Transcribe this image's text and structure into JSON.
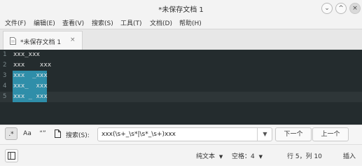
{
  "window": {
    "title": "*未保存文档 1",
    "minimize_glyph": "⌄",
    "maximize_glyph": "^",
    "close_glyph": "×"
  },
  "menu": {
    "file": "文件(F)",
    "edit": "编辑(E)",
    "view": "查看(V)",
    "search": "搜索(S)",
    "tools": "工具(T)",
    "documents": "文档(D)",
    "help": "帮助(H)"
  },
  "tab": {
    "label": "*未保存文档 1",
    "close_glyph": "×"
  },
  "editor": {
    "lines": [
      {
        "number": "1",
        "text": "xxx_xxx"
      },
      {
        "number": "2",
        "text": "xxx    xxx"
      },
      {
        "number": "3",
        "text": "xxx  _xxx"
      },
      {
        "number": "4",
        "text": "xxx_  xxx"
      },
      {
        "number": "5",
        "text": "xxx _ xxx"
      }
    ],
    "selected_lines": [
      "3",
      "4",
      "5"
    ],
    "current_line": "5"
  },
  "find": {
    "regex_option": ".*",
    "case_option": "Aa",
    "whole_word_option": "“”",
    "wrap_icon": "wrap-around-icon",
    "label": "搜索(S):",
    "value": "xxx(\\s+_\\s*|\\s*_\\s+)xxx",
    "next": "下一个",
    "previous": "上一个"
  },
  "status": {
    "syntax": "纯文本",
    "tab_width": "空格：4",
    "dropdown_glyph": "▼",
    "position": "行 5，列 10",
    "mode": "插入"
  },
  "colors": {
    "editor_background": "#242c2e",
    "selection": "#2f8ea9"
  }
}
